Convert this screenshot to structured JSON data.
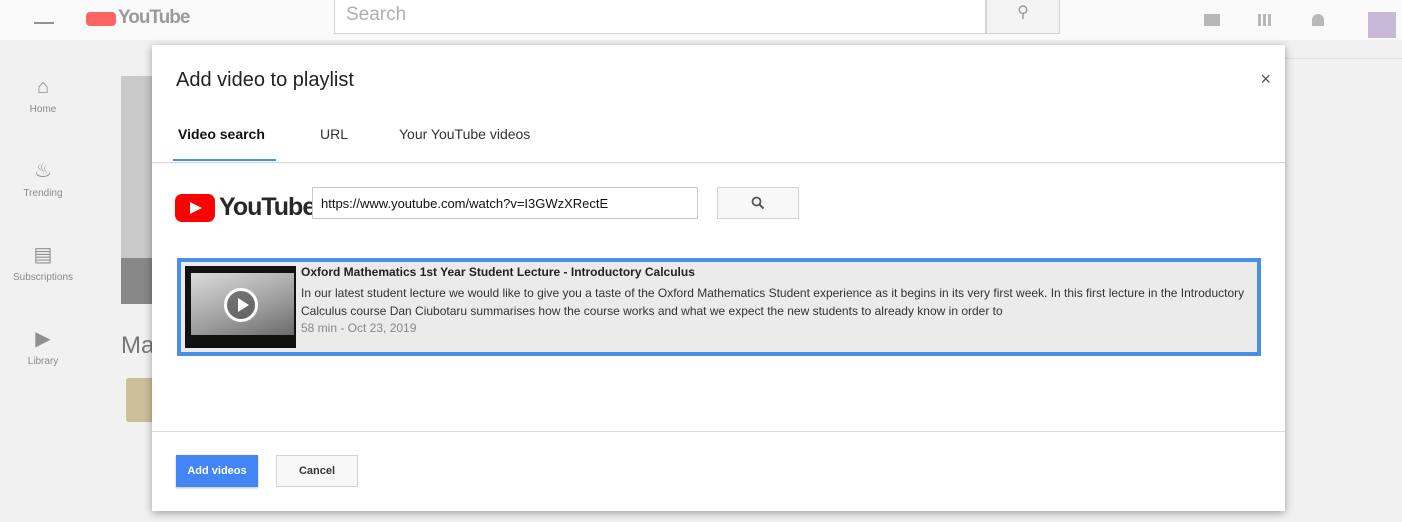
{
  "background": {
    "logo_text": "YouTube",
    "search_placeholder": "Search",
    "nav": [
      {
        "label": "Home",
        "icon": "home-icon"
      },
      {
        "label": "Trending",
        "icon": "flame-icon"
      },
      {
        "label": "Subscriptions",
        "icon": "subscriptions-icon"
      },
      {
        "label": "Library",
        "icon": "library-icon"
      }
    ],
    "channel_initials": "Ma"
  },
  "dialog": {
    "title": "Add video to playlist",
    "close_label": "×",
    "tabs": [
      {
        "label": "Video search",
        "active": true
      },
      {
        "label": "URL",
        "active": false
      },
      {
        "label": "Your YouTube videos",
        "active": false
      }
    ],
    "logo_wordmark": "YouTube",
    "search_value": "https://www.youtube.com/watch?v=I3GWzXRectE",
    "result": {
      "title": "Oxford Mathematics 1st Year Student Lecture - Introductory Calculus",
      "description": "In our latest student lecture we would like to give you a taste of the Oxford Mathematics Student experience as it begins in its very first week. In this first lecture in the Introductory Calculus course Dan Ciubotaru summarises how the course works and what we expect the new students to already know in order to",
      "meta": "58 min - Oct 23, 2019"
    },
    "add_label": "Add videos",
    "cancel_label": "Cancel"
  },
  "colors": {
    "accent": "#4a8fe3",
    "primary_button": "#4285f4",
    "youtube_red": "#ff0000"
  }
}
